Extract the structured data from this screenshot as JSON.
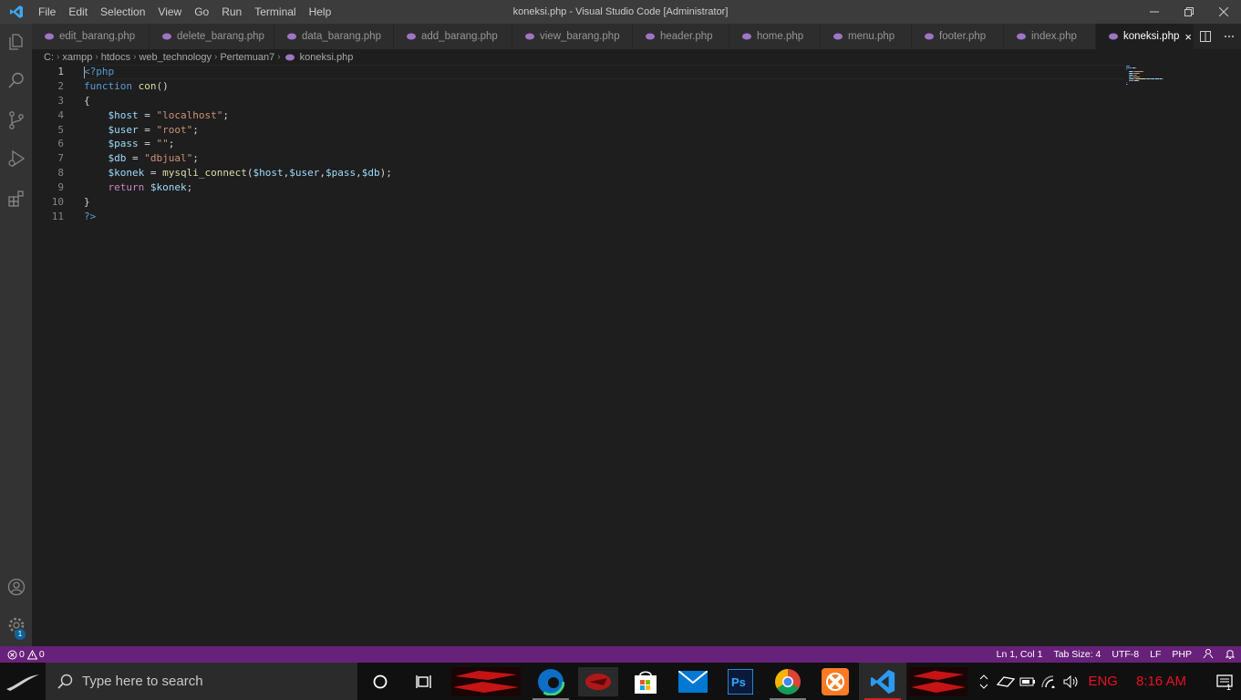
{
  "window": {
    "title": "koneksi.php - Visual Studio Code [Administrator]",
    "menu": [
      "File",
      "Edit",
      "Selection",
      "View",
      "Go",
      "Run",
      "Terminal",
      "Help"
    ]
  },
  "tabs": [
    {
      "label": "edit_barang.php",
      "active": false
    },
    {
      "label": "delete_barang.php",
      "active": false
    },
    {
      "label": "data_barang.php",
      "active": false
    },
    {
      "label": "add_barang.php",
      "active": false
    },
    {
      "label": "view_barang.php",
      "active": false
    },
    {
      "label": "header.php",
      "active": false
    },
    {
      "label": "home.php",
      "active": false
    },
    {
      "label": "menu.php",
      "active": false
    },
    {
      "label": "footer.php",
      "active": false
    },
    {
      "label": "index.php",
      "active": false
    },
    {
      "label": "koneksi.php",
      "active": true
    }
  ],
  "breadcrumb": [
    "C:",
    "xampp",
    "htdocs",
    "web_technology",
    "Pertemuan7",
    "koneksi.php"
  ],
  "editor": {
    "line_numbers": [
      "1",
      "2",
      "3",
      "4",
      "5",
      "6",
      "7",
      "8",
      "9",
      "10",
      "11"
    ],
    "lines": [
      [
        {
          "t": "php",
          "v": "<?php"
        }
      ],
      [
        {
          "t": "kw",
          "v": "function"
        },
        {
          "t": "pl",
          "v": " "
        },
        {
          "t": "fn",
          "v": "con"
        },
        {
          "t": "pl",
          "v": "()"
        }
      ],
      [
        {
          "t": "pl",
          "v": "{"
        }
      ],
      [
        {
          "t": "pl",
          "v": "    "
        },
        {
          "t": "var",
          "v": "$host"
        },
        {
          "t": "pl",
          "v": " = "
        },
        {
          "t": "str",
          "v": "\"localhost\""
        },
        {
          "t": "pl",
          "v": ";"
        }
      ],
      [
        {
          "t": "pl",
          "v": "    "
        },
        {
          "t": "var",
          "v": "$user"
        },
        {
          "t": "pl",
          "v": " = "
        },
        {
          "t": "str",
          "v": "\"root\""
        },
        {
          "t": "pl",
          "v": ";"
        }
      ],
      [
        {
          "t": "pl",
          "v": "    "
        },
        {
          "t": "var",
          "v": "$pass"
        },
        {
          "t": "pl",
          "v": " = "
        },
        {
          "t": "str",
          "v": "\"\""
        },
        {
          "t": "pl",
          "v": ";"
        }
      ],
      [
        {
          "t": "pl",
          "v": "    "
        },
        {
          "t": "var",
          "v": "$db"
        },
        {
          "t": "pl",
          "v": " = "
        },
        {
          "t": "str",
          "v": "\"dbjual\""
        },
        {
          "t": "pl",
          "v": ";"
        }
      ],
      [
        {
          "t": "pl",
          "v": "    "
        },
        {
          "t": "var",
          "v": "$konek"
        },
        {
          "t": "pl",
          "v": " = "
        },
        {
          "t": "fn",
          "v": "mysqli_connect"
        },
        {
          "t": "pl",
          "v": "("
        },
        {
          "t": "var",
          "v": "$host"
        },
        {
          "t": "pl",
          "v": ","
        },
        {
          "t": "var",
          "v": "$user"
        },
        {
          "t": "pl",
          "v": ","
        },
        {
          "t": "var",
          "v": "$pass"
        },
        {
          "t": "pl",
          "v": ","
        },
        {
          "t": "var",
          "v": "$db"
        },
        {
          "t": "pl",
          "v": ");"
        }
      ],
      [
        {
          "t": "pl",
          "v": "    "
        },
        {
          "t": "ctl",
          "v": "return"
        },
        {
          "t": "pl",
          "v": " "
        },
        {
          "t": "var",
          "v": "$konek"
        },
        {
          "t": "pl",
          "v": ";"
        }
      ],
      [
        {
          "t": "pl",
          "v": "}"
        }
      ],
      [
        {
          "t": "php",
          "v": "?>"
        }
      ]
    ]
  },
  "statusbar": {
    "errors": "0",
    "warnings": "0",
    "position": "Ln 1, Col 1",
    "tab_size": "Tab Size: 4",
    "encoding": "UTF-8",
    "eol": "LF",
    "language": "PHP"
  },
  "taskbar": {
    "search_placeholder": "Type here to search",
    "language": "ENG",
    "time": "8:16 AM",
    "notification_count": "1",
    "icons": [
      "rog-wallpaper-icon",
      "edge-icon",
      "rog-armoury-icon",
      "store-icon",
      "mail-icon",
      "photoshop-icon",
      "chrome-icon",
      "xampp-icon",
      "vscode-icon",
      "rog-app-icon"
    ]
  },
  "activity_badge": "1",
  "colors": {
    "statusbar": "#68217a",
    "titlebar": "#3c3c3c",
    "activitybar": "#333333",
    "editor_bg": "#1e1e1e",
    "tray_text": "#e81123"
  }
}
